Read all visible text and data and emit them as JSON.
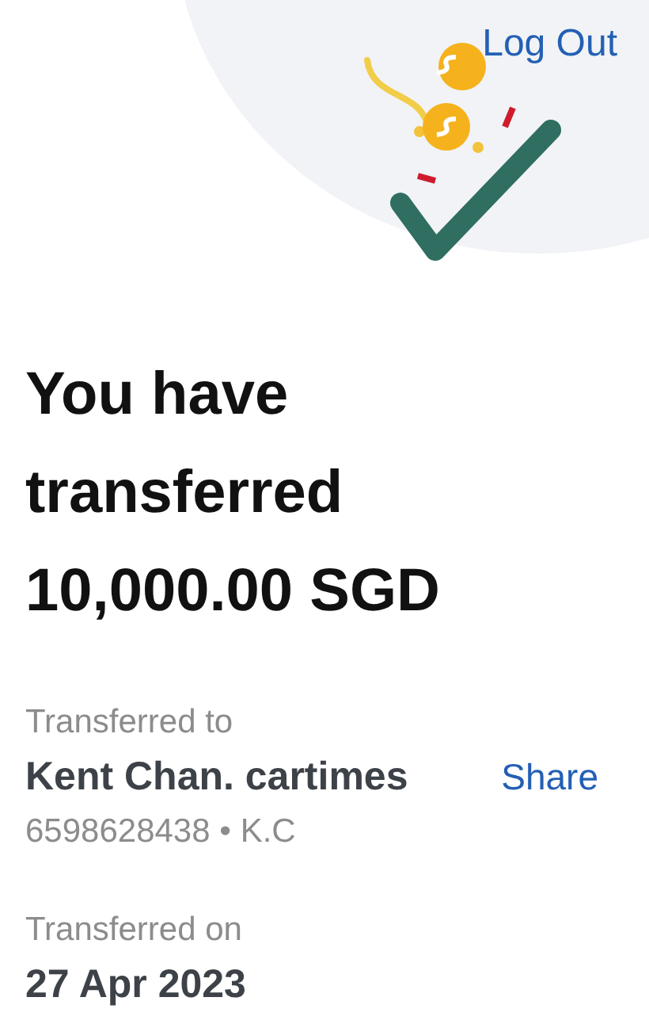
{
  "header": {
    "logout": "Log Out"
  },
  "title": "You have transferred 10,000.00 SGD",
  "recipient": {
    "label": "Transferred to",
    "name": "Kent Chan. cartimes",
    "account": "6598628438 • K.C",
    "share": "Share"
  },
  "date": {
    "label": "Transferred on",
    "value": "27 Apr 2023"
  }
}
